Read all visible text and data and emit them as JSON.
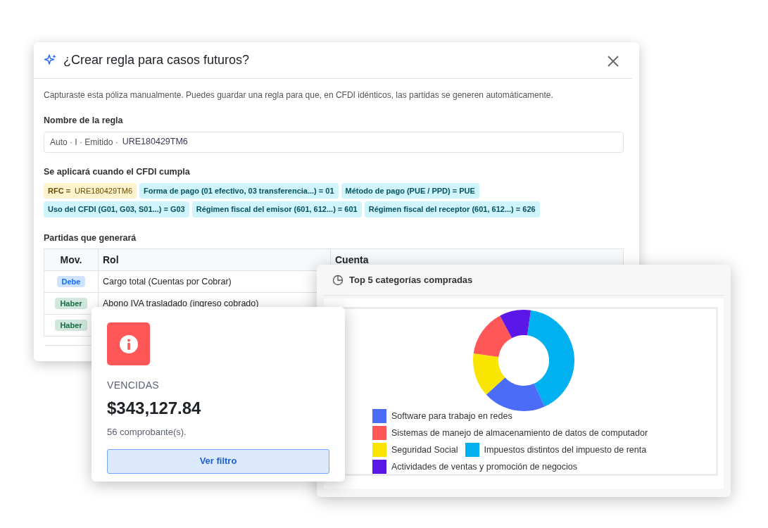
{
  "rule_dialog": {
    "title": "¿Crear regla para casos futuros?",
    "description": "Capturaste esta póliza manualmente. Puedes guardar una regla para que, en CFDI idénticos, las partidas se generen automáticamente.",
    "name_label": "Nombre de la regla",
    "name_prefix": "Auto · I · Emitido ·",
    "name_value": "URE180429TM6",
    "conditions_label": "Se aplicará cuando el CFDI cumpla",
    "conditions": [
      {
        "kind": "rfc",
        "label": "RFC =",
        "value": "URE180429TM6"
      },
      {
        "kind": "field",
        "label": "Forma de pago (01 efectivo, 03 transferencia...) = 01"
      },
      {
        "kind": "field",
        "label": "Método de pago (PUE / PPD) = PUE"
      },
      {
        "kind": "field",
        "label": "Uso del CFDI (G01, G03, S01...) = G03"
      },
      {
        "kind": "field",
        "label": "Régimen fiscal del emisor (601, 612...) = 601"
      },
      {
        "kind": "field",
        "label": "Régimen fiscal del receptor (601, 612...) = 626"
      }
    ],
    "entries_label": "Partidas que generará",
    "columns": [
      "Mov.",
      "Rol",
      "Cuenta"
    ],
    "rows": [
      {
        "kind": "debit",
        "mov": "Debe",
        "rol": "Cargo total (Cuentas por Cobrar)"
      },
      {
        "kind": "credit",
        "mov": "Haber",
        "rol": "Abono IVA trasladado (ingreso cobrado)"
      },
      {
        "kind": "credit",
        "mov": "Haber"
      }
    ]
  },
  "overdue_card": {
    "label": "VENCIDAS",
    "amount": "$343,127.84",
    "count": "56 comprobante(s).",
    "button": "Ver filtro"
  },
  "chart_card": {
    "title": "Top 5 categorías compradas",
    "legend": [
      {
        "label": "Software para trabajo en redes",
        "color": "#4b6cf7"
      },
      {
        "label": "Sistemas de manejo de almacenamiento de datos de computador",
        "color": "#ff5757"
      },
      {
        "label": "Seguridad Social",
        "color": "#fae500"
      },
      {
        "label": "Impuestos distintos del impuesto de renta",
        "color": "#00b0ef"
      },
      {
        "label": "Actividades de ventas y promoción de negocios",
        "color": "#5b17e8"
      }
    ]
  }
}
